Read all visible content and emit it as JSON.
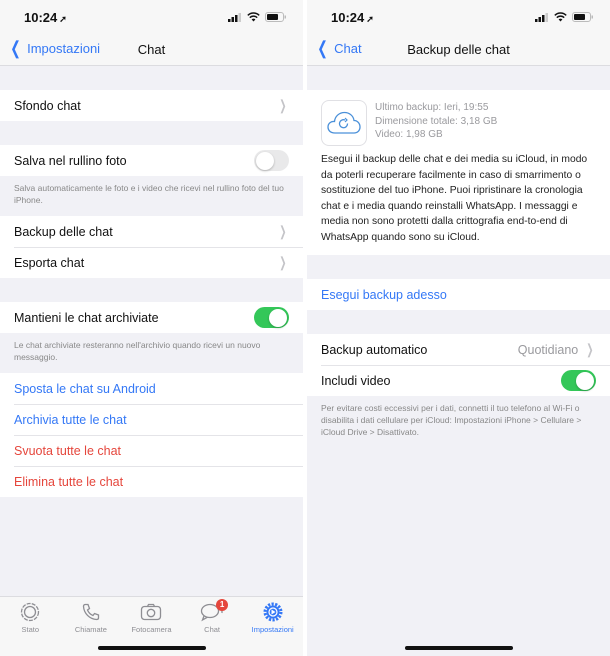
{
  "status_bar": {
    "time": "10:24",
    "location_icon": "location-arrow-icon"
  },
  "left_screen": {
    "nav": {
      "back_label": "Impostazioni",
      "title": "Chat"
    },
    "wallpaper_row": {
      "label": "Sfondo chat"
    },
    "save_photos": {
      "label": "Salva nel rullino foto",
      "enabled": false,
      "footnote": "Salva automaticamente le foto e i video che ricevi nel rullino foto del tuo iPhone."
    },
    "backup_rows": [
      {
        "label": "Backup delle chat"
      },
      {
        "label": "Esporta chat"
      }
    ],
    "keep_archived": {
      "label": "Mantieni le chat archiviate",
      "enabled": true,
      "footnote": "Le chat archiviate resteranno nell'archivio quando ricevi un nuovo messaggio."
    },
    "actions": [
      {
        "label": "Sposta le chat su Android",
        "color": "#3478f6"
      },
      {
        "label": "Archivia tutte le chat",
        "color": "#3478f6"
      },
      {
        "label": "Svuota tutte le chat",
        "color": "#e5463c"
      },
      {
        "label": "Elimina tutte le chat",
        "color": "#e5463c"
      }
    ],
    "tabbar": {
      "tabs": [
        {
          "label": "Stato",
          "icon": "status-icon",
          "active": false
        },
        {
          "label": "Chiamate",
          "icon": "phone-icon",
          "active": false
        },
        {
          "label": "Fotocamera",
          "icon": "camera-icon",
          "active": false
        },
        {
          "label": "Chat",
          "icon": "chat-bubbles-icon",
          "active": false,
          "badge": "1"
        },
        {
          "label": "Impostazioni",
          "icon": "settings-gear-icon",
          "active": true
        }
      ]
    }
  },
  "right_screen": {
    "nav": {
      "back_label": "Chat",
      "title": "Backup delle chat"
    },
    "backup_info": {
      "last_backup": "Ultimo backup: Ieri, 19:55",
      "total_size": "Dimensione totale: 3,18 GB",
      "video_size": "Video: 1,98 GB",
      "description": "Esegui il backup delle chat e dei media su iCloud, in modo da poterli recuperare facilmente in caso di smarrimento o sostituzione del tuo iPhone. Puoi ripristinare la cronologia chat e i media quando reinstalli WhatsApp. I messaggi e media non sono protetti dalla crittografia end-to-end di WhatsApp quando sono su iCloud."
    },
    "backup_now": {
      "label": "Esegui backup adesso"
    },
    "auto_backup": {
      "label": "Backup automatico",
      "value": "Quotidiano"
    },
    "include_video": {
      "label": "Includi video",
      "enabled": true
    },
    "footnote": "Per evitare costi eccessivi per i dati, connetti il tuo telefono al Wi-Fi o disabilita i dati cellulare per iCloud: Impostazioni iPhone > Cellulare > iCloud Drive > Disattivato."
  },
  "colors": {
    "accent": "#3478f6",
    "destructive": "#e5463c",
    "toggle_on": "#34c759",
    "badge": "#e5463c"
  }
}
